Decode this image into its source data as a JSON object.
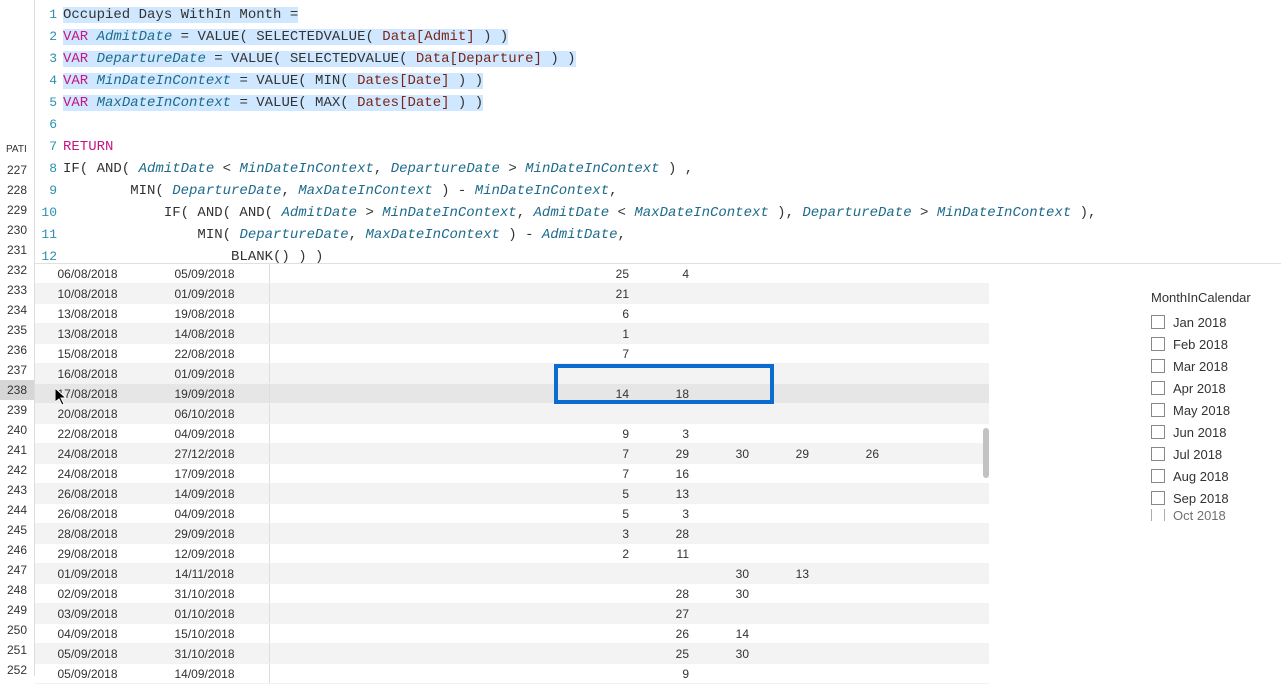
{
  "editor": {
    "title": "Occupied Days WithIn Month =",
    "lines": [
      {
        "no": 1,
        "raw": "Occupied Days WithIn Month =",
        "sel": true
      },
      {
        "no": 2,
        "raw": "VAR AdmitDate = VALUE( SELECTEDVALUE( Data[Admit] ) )",
        "sel": true
      },
      {
        "no": 3,
        "raw": "VAR DepartureDate = VALUE( SELECTEDVALUE( Data[Departure] ) )",
        "sel": true
      },
      {
        "no": 4,
        "raw": "VAR MinDateInContext = VALUE( MIN( Dates[Date] ) )",
        "sel": true
      },
      {
        "no": 5,
        "raw": "VAR MaxDateInContext = VALUE( MAX( Dates[Date] ) )",
        "sel": true
      },
      {
        "no": 6,
        "raw": "",
        "sel": false
      },
      {
        "no": 7,
        "raw": "RETURN",
        "sel": false
      },
      {
        "no": 8,
        "raw": "IF( AND( AdmitDate < MinDateInContext, DepartureDate > MinDateInContext ) ,",
        "sel": false
      },
      {
        "no": 9,
        "raw": "        MIN( DepartureDate, MaxDateInContext ) - MinDateInContext,",
        "sel": false
      },
      {
        "no": 10,
        "raw": "            IF( AND( AND( AdmitDate > MinDateInContext, AdmitDate < MaxDateInContext ), DepartureDate > MinDateInContext ),",
        "sel": false
      },
      {
        "no": 11,
        "raw": "                MIN( DepartureDate, MaxDateInContext ) - AdmitDate,",
        "sel": false
      },
      {
        "no": 12,
        "raw": "                    BLANK() ) )",
        "sel": false
      }
    ]
  },
  "left_gutter": {
    "header": "PATI",
    "rows": [
      227,
      228,
      229,
      230,
      231,
      232,
      233,
      234,
      235,
      236,
      237,
      238,
      239,
      240,
      241,
      242,
      243,
      244,
      245,
      246,
      247,
      248,
      249,
      250,
      251,
      252
    ],
    "highlight": 238
  },
  "table": {
    "rows": [
      {
        "n": 232,
        "admit": "06/08/2018",
        "dep": "05/09/2018",
        "v1": "25",
        "v2": "4",
        "v3": "",
        "v4": "",
        "v5": ""
      },
      {
        "n": 233,
        "admit": "10/08/2018",
        "dep": "01/09/2018",
        "v1": "21",
        "v2": "",
        "v3": "",
        "v4": "",
        "v5": ""
      },
      {
        "n": 234,
        "admit": "13/08/2018",
        "dep": "19/08/2018",
        "v1": "6",
        "v2": "",
        "v3": "",
        "v4": "",
        "v5": ""
      },
      {
        "n": 235,
        "admit": "13/08/2018",
        "dep": "14/08/2018",
        "v1": "1",
        "v2": "",
        "v3": "",
        "v4": "",
        "v5": ""
      },
      {
        "n": 236,
        "admit": "15/08/2018",
        "dep": "22/08/2018",
        "v1": "7",
        "v2": "",
        "v3": "",
        "v4": "",
        "v5": ""
      },
      {
        "n": 237,
        "admit": "16/08/2018",
        "dep": "01/09/2018",
        "v1": "",
        "v2": "",
        "v3": "",
        "v4": "",
        "v5": ""
      },
      {
        "n": 238,
        "admit": "17/08/2018",
        "dep": "19/09/2018",
        "v1": "14",
        "v2": "18",
        "v3": "",
        "v4": "",
        "v5": ""
      },
      {
        "n": 239,
        "admit": "20/08/2018",
        "dep": "06/10/2018",
        "v1": "",
        "v2": "",
        "v3": "",
        "v4": "",
        "v5": ""
      },
      {
        "n": 240,
        "admit": "22/08/2018",
        "dep": "04/09/2018",
        "v1": "9",
        "v2": "3",
        "v3": "",
        "v4": "",
        "v5": ""
      },
      {
        "n": 241,
        "admit": "24/08/2018",
        "dep": "27/12/2018",
        "v1": "7",
        "v2": "29",
        "v3": "30",
        "v4": "29",
        "v5": "26"
      },
      {
        "n": 242,
        "admit": "24/08/2018",
        "dep": "17/09/2018",
        "v1": "7",
        "v2": "16",
        "v3": "",
        "v4": "",
        "v5": ""
      },
      {
        "n": 243,
        "admit": "26/08/2018",
        "dep": "14/09/2018",
        "v1": "5",
        "v2": "13",
        "v3": "",
        "v4": "",
        "v5": ""
      },
      {
        "n": 244,
        "admit": "26/08/2018",
        "dep": "04/09/2018",
        "v1": "5",
        "v2": "3",
        "v3": "",
        "v4": "",
        "v5": ""
      },
      {
        "n": 245,
        "admit": "28/08/2018",
        "dep": "29/09/2018",
        "v1": "3",
        "v2": "28",
        "v3": "",
        "v4": "",
        "v5": ""
      },
      {
        "n": 246,
        "admit": "29/08/2018",
        "dep": "12/09/2018",
        "v1": "2",
        "v2": "11",
        "v3": "",
        "v4": "",
        "v5": ""
      },
      {
        "n": 247,
        "admit": "01/09/2018",
        "dep": "14/11/2018",
        "v1": "",
        "v2": "",
        "v3": "30",
        "v4": "13",
        "v5": ""
      },
      {
        "n": 248,
        "admit": "02/09/2018",
        "dep": "31/10/2018",
        "v1": "",
        "v2": "28",
        "v3": "30",
        "v4": "",
        "v5": ""
      },
      {
        "n": 249,
        "admit": "03/09/2018",
        "dep": "01/10/2018",
        "v1": "",
        "v2": "27",
        "v3": "",
        "v4": "",
        "v5": ""
      },
      {
        "n": 250,
        "admit": "04/09/2018",
        "dep": "15/10/2018",
        "v1": "",
        "v2": "26",
        "v3": "14",
        "v4": "",
        "v5": ""
      },
      {
        "n": 251,
        "admit": "05/09/2018",
        "dep": "31/10/2018",
        "v1": "",
        "v2": "25",
        "v3": "30",
        "v4": "",
        "v5": ""
      },
      {
        "n": 252,
        "admit": "05/09/2018",
        "dep": "14/09/2018",
        "v1": "",
        "v2": "9",
        "v3": "",
        "v4": "",
        "v5": ""
      }
    ],
    "highlightRow": 238
  },
  "slicer": {
    "title": "MonthInCalendar",
    "items": [
      "Jan 2018",
      "Feb 2018",
      "Mar 2018",
      "Apr 2018",
      "May 2018",
      "Jun 2018",
      "Jul 2018",
      "Aug 2018",
      "Sep 2018",
      "Oct 2018"
    ]
  }
}
